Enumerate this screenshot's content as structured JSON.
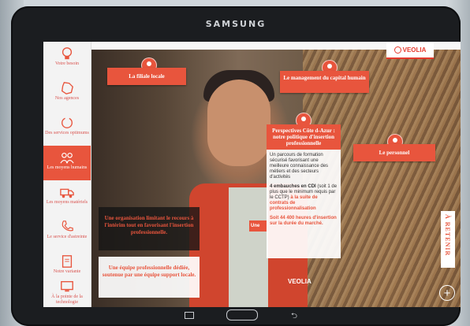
{
  "device": {
    "brand": "SAMSUNG"
  },
  "app": {
    "logo_text": "VEOLIA"
  },
  "sidebar": {
    "items": [
      {
        "label": "Votre besoin",
        "icon": "lightbulb-icon"
      },
      {
        "label": "Nos agences",
        "icon": "france-map-icon"
      },
      {
        "label": "Des services optimums",
        "icon": "cycle-icon"
      },
      {
        "label": "Les moyens humains",
        "icon": "people-icon",
        "active": true
      },
      {
        "label": "Les moyens matériels",
        "icon": "truck-icon"
      },
      {
        "label": "Le service d'astreinte",
        "icon": "phone-icon"
      },
      {
        "label": "Notre variante",
        "icon": "document-icon"
      },
      {
        "label": "À la pointe de la technologie",
        "icon": "screen-icon"
      }
    ]
  },
  "hotspots": {
    "filiale": "La filiale locale",
    "management": "Le management du capital humain",
    "personnel": "Le personnel"
  },
  "popup": {
    "title": "Perspectives Côte d-Azur : notre politique d'insertion professionnelle",
    "p1": "Un parcours de formation sécurisé favorisant une meilleure connaissance des métiers et des secteurs d'activités",
    "p2_bold": "4 embauches en CDI",
    "p2_rest": " (soit 1 de plus que le minimum requis par le CCTP) ",
    "p2_red": "à la suite de contrats de professionnalisation",
    "p3": "Soit 44 400 heures d'insertion sur la durée du marché."
  },
  "clipped_label": "Une",
  "panels": {
    "dark": "Une organisation limitant le recours à l'intérim tout en favorisant l'insertion professionnelle.",
    "light": "Une équipe professionnelle dédiée, soutenue par une équipe support locale."
  },
  "retenir_label": "À RETENIR",
  "plus_label": "+",
  "colors": {
    "accent": "#e8553d",
    "brand_red": "#e63a2d"
  }
}
